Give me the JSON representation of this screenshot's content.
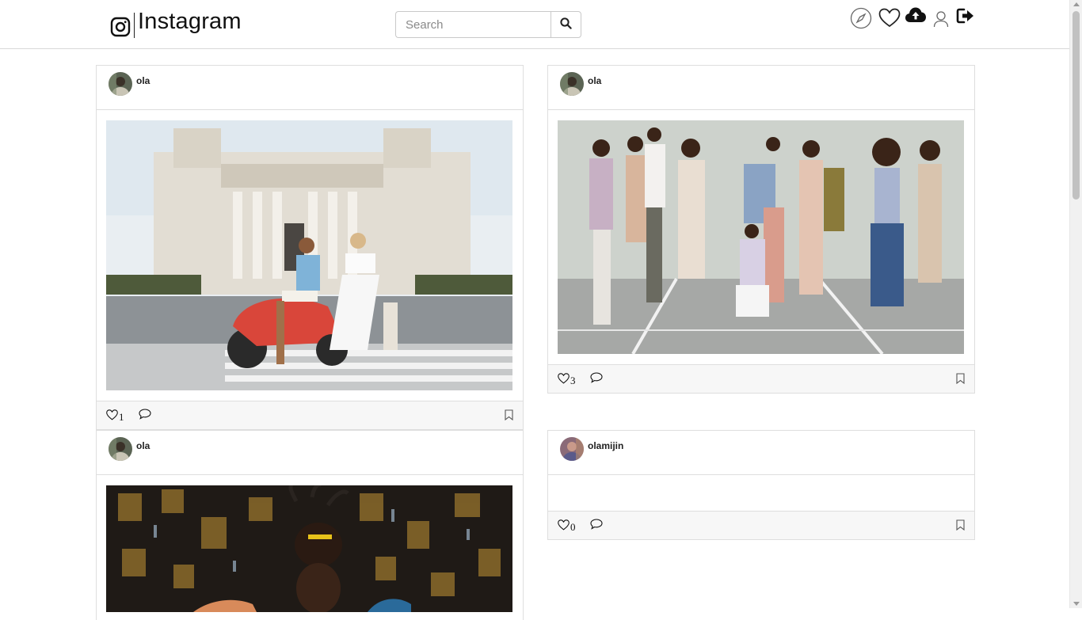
{
  "brand": {
    "title": "Instagram"
  },
  "search": {
    "placeholder": "Search",
    "value": ""
  },
  "nav_icons": [
    "compass-icon",
    "heart-icon",
    "cloud-upload-icon",
    "user-icon",
    "sign-out-icon"
  ],
  "posts": [
    {
      "username": "ola",
      "likes": "1",
      "image": "couple on red scooter in front of neoclassical building",
      "avatar_color": "#556050"
    },
    {
      "username": "ola",
      "likes": "3",
      "image": "group of dancers posing on court",
      "avatar_color": "#556050"
    },
    {
      "username": "ola",
      "likes": "",
      "image": "portrait of man with dreadlocks on dark patterned backdrop",
      "avatar_color": "#556050"
    },
    {
      "username": "olamijin",
      "likes": "0",
      "image": "",
      "avatar_color": "#8a6a78"
    }
  ],
  "colors": {
    "border": "#dedede",
    "footer_bg": "#f7f7f7",
    "text": "#111111"
  }
}
